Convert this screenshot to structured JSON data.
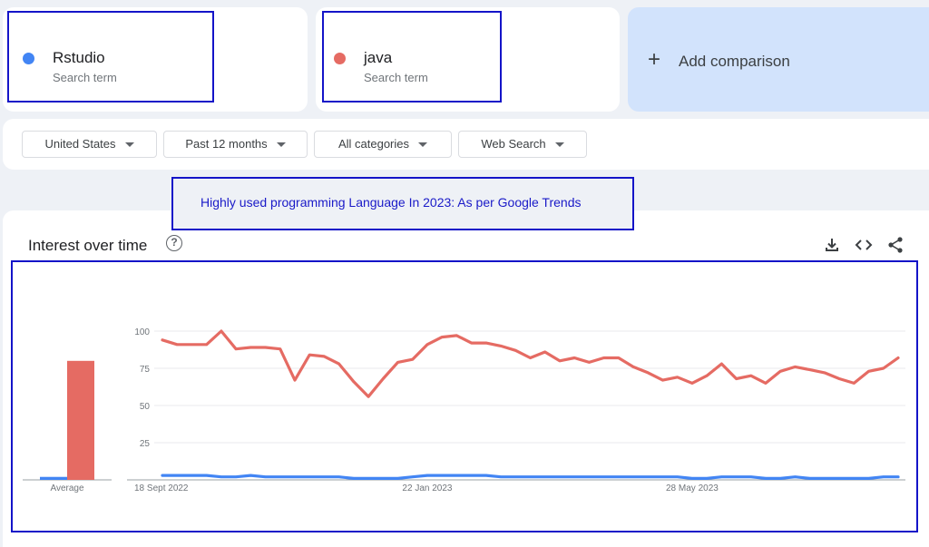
{
  "terms": [
    {
      "name": "Rstudio",
      "subtitle": "Search term",
      "color": "#4285f4"
    },
    {
      "name": "java",
      "subtitle": "Search term",
      "color": "#e56b63"
    }
  ],
  "add_comparison": {
    "icon": "plus-icon",
    "label": "Add comparison"
  },
  "filters": [
    {
      "label": "United States"
    },
    {
      "label": "Past 12 months"
    },
    {
      "label": "All categories"
    },
    {
      "label": "Web Search"
    }
  ],
  "banner": {
    "text": "Highly used programming Language In 2023: As per Google Trends"
  },
  "chart_card": {
    "title": "Interest over time",
    "icons": [
      "help-icon",
      "download-icon",
      "embed-icon",
      "share-icon"
    ]
  },
  "chart_data": {
    "type": "line",
    "ylim": [
      0,
      100
    ],
    "yticks": [
      25,
      50,
      75,
      100
    ],
    "grid": true,
    "x_tick_labels": [
      "18 Sept 2022",
      "22 Jan 2023",
      "28 May 2023"
    ],
    "x_tick_indices": [
      0,
      18,
      36
    ],
    "average_label": "Average",
    "averages": [
      {
        "series": "Rstudio",
        "value": 2,
        "color": "#4285f4"
      },
      {
        "series": "java",
        "value": 80,
        "color": "#e56b63"
      }
    ],
    "series": [
      {
        "name": "java",
        "color": "#e56b63",
        "values": [
          94,
          91,
          91,
          91,
          100,
          88,
          89,
          89,
          88,
          67,
          84,
          83,
          78,
          66,
          56,
          68,
          79,
          81,
          91,
          96,
          97,
          92,
          92,
          90,
          87,
          82,
          86,
          80,
          82,
          79,
          82,
          82,
          76,
          72,
          67,
          69,
          65,
          70,
          78,
          68,
          70,
          65,
          73,
          76,
          74,
          72,
          68,
          65,
          73,
          75,
          82
        ]
      },
      {
        "name": "Rstudio",
        "color": "#4285f4",
        "values": [
          3,
          3,
          3,
          3,
          2,
          2,
          3,
          2,
          2,
          2,
          2,
          2,
          2,
          1,
          1,
          1,
          1,
          2,
          3,
          3,
          3,
          3,
          3,
          2,
          2,
          2,
          2,
          2,
          2,
          2,
          2,
          2,
          2,
          2,
          2,
          2,
          1,
          1,
          2,
          2,
          2,
          1,
          1,
          2,
          1,
          1,
          1,
          1,
          1,
          2,
          2
        ]
      }
    ]
  }
}
